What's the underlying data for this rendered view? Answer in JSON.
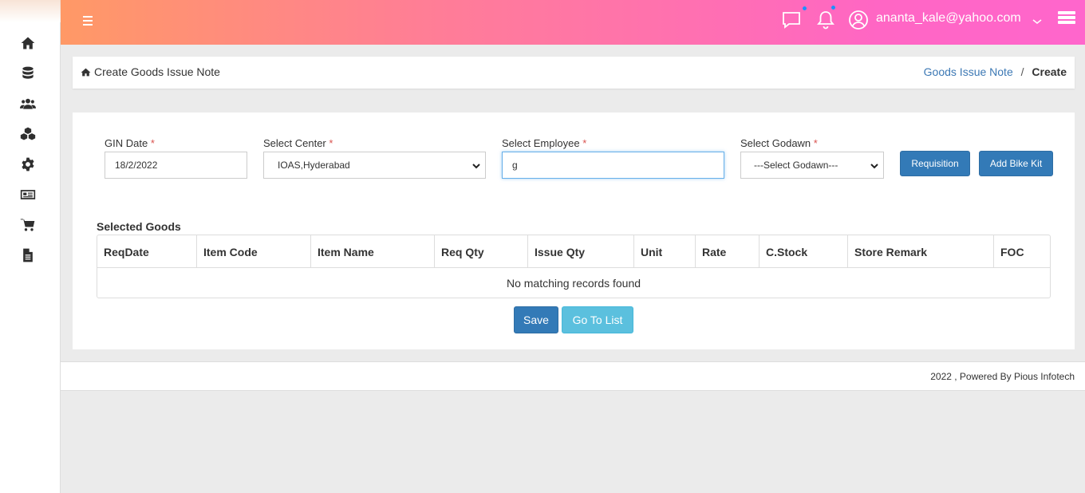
{
  "header": {
    "user_email": "ananta_kale@yahoo.com"
  },
  "breadcrumb": {
    "page_title": "Create Goods Issue Note",
    "parent_link": "Goods Issue Note",
    "separator": "/",
    "current": "Create"
  },
  "form": {
    "gin_date": {
      "label": "GIN Date",
      "required": "*",
      "value": "18/2/2022"
    },
    "center": {
      "label": "Select Center",
      "required": "*",
      "value": "IOAS,Hyderabad"
    },
    "employee": {
      "label": "Select Employee",
      "required": "*",
      "value": "g"
    },
    "godawn": {
      "label": "Select Godawn",
      "required": "*",
      "value": "---Select Godawn---"
    },
    "requisition_button": "Requisition",
    "add_bike_kit_button": "Add Bike Kit"
  },
  "selected_goods": {
    "title": "Selected Goods",
    "columns": [
      "ReqDate",
      "Item Code",
      "Item Name",
      "Req Qty",
      "Issue Qty",
      "Unit",
      "Rate",
      "C.Stock",
      "Store Remark",
      "FOC"
    ],
    "empty_message": "No matching records found"
  },
  "actions": {
    "save": "Save",
    "go_to_list": "Go To List"
  },
  "footer": {
    "text": "2022 , Powered By Pious Infotech"
  },
  "colors": {
    "header_gradient_start": "#ff9966",
    "header_gradient_end": "#ff66cc",
    "primary_button": "#337ab7",
    "info_button": "#5bc0de",
    "link": "#3c78b4",
    "required": "#d9534f"
  },
  "icons": {
    "sidebar": [
      "home-icon",
      "database-icon",
      "users-icon",
      "cubes-icon",
      "gear-icon",
      "newspaper-icon",
      "cart-icon",
      "file-icon"
    ],
    "header": [
      "menu-icon",
      "chat-icon",
      "bell-icon",
      "user-icon",
      "chevron-down-icon",
      "grid-icon"
    ]
  }
}
